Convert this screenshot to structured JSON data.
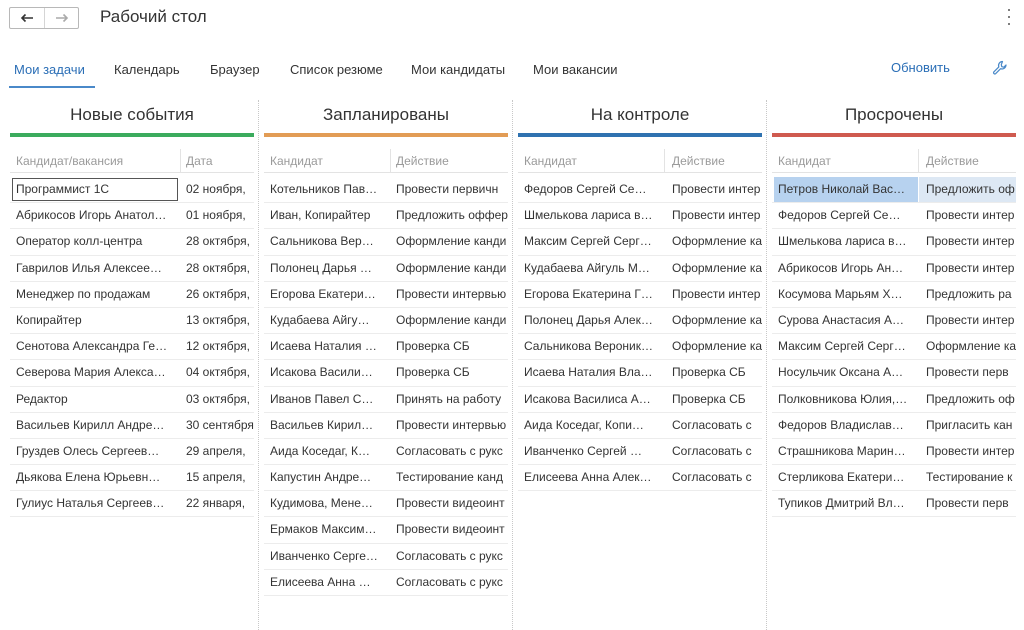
{
  "window": {
    "title": "Рабочий стол"
  },
  "icons": {
    "back": "arrow-left-icon",
    "forward": "arrow-right-icon",
    "menu": "kebab-menu-icon",
    "settings": "wrench-icon"
  },
  "tabs": [
    "Мои задачи",
    "Календарь",
    "Браузер",
    "Список резюме",
    "Мои кандидаты",
    "Мои вакансии"
  ],
  "actions": {
    "refresh": "Обновить"
  },
  "colors": {
    "accent": "#2a6eb6",
    "new": "#3bab5d",
    "planned": "#e29c55",
    "control": "#2f72b0",
    "overdue": "#cf5a4f",
    "selected": "#b7d2ef"
  },
  "columns": [
    {
      "title": "Новые события",
      "headers": [
        "Кандидат/вакансия",
        "Дата"
      ],
      "rows": [
        [
          "Программист 1С",
          "02 ноября,"
        ],
        [
          "Абрикосов Игорь Анатол…",
          "01 ноября,"
        ],
        [
          "Оператор колл-центра",
          "28 октября,"
        ],
        [
          "Гаврилов Илья Алексее…",
          "28 октября,"
        ],
        [
          "Менеджер по продажам",
          "26 октября,"
        ],
        [
          "Копирайтер",
          "13 октября,"
        ],
        [
          "Сенотова Александра Ге…",
          "12 октября,"
        ],
        [
          "Северова Мария Алекса…",
          "04 октября,"
        ],
        [
          "Редактор",
          "03 октября,"
        ],
        [
          "Васильев Кирилл Андре…",
          "30 сентября"
        ],
        [
          "Груздев Олесь Сергеев…",
          "29 апреля,"
        ],
        [
          "Дьякова Елена Юрьевн…",
          "15 апреля,"
        ],
        [
          "Гулиус Наталья Сергеев…",
          "22 января,"
        ]
      ]
    },
    {
      "title": "Запланированы",
      "headers": [
        "Кандидат",
        "Действие"
      ],
      "rows": [
        [
          "Котельников Пав…",
          "Провести первичн"
        ],
        [
          "Иван, Копирайтер",
          "Предложить оффер"
        ],
        [
          "Сальникова Вер…",
          "Оформление канди"
        ],
        [
          "Полонец Дарья …",
          "Оформление канди"
        ],
        [
          "Егорова Екатери…",
          "Провести интервью"
        ],
        [
          "Кудабаева Айгу…",
          "Оформление канди"
        ],
        [
          "Исаева Наталия …",
          "Проверка СБ"
        ],
        [
          "Исакова Васили…",
          "Проверка СБ"
        ],
        [
          "Иванов Павел С…",
          "Принять на работу"
        ],
        [
          "Васильев Кирил…",
          "Провести интервью"
        ],
        [
          "Аида Коседаг, К…",
          "Согласовать с рукс"
        ],
        [
          "Капустин Андре…",
          "Тестирование канд"
        ],
        [
          "Кудимова, Мене…",
          "Провести видеоинт"
        ],
        [
          "Ермаков Максим…",
          "Провести видеоинт"
        ],
        [
          "Иванченко Серге…",
          "Согласовать с рукс"
        ],
        [
          "Елисеева Анна …",
          "Согласовать с рукс"
        ]
      ]
    },
    {
      "title": "На контроле",
      "headers": [
        "Кандидат",
        "Действие"
      ],
      "rows": [
        [
          "Федоров Сергей Се…",
          "Провести интер"
        ],
        [
          "Шмелькова лариса в…",
          "Провести интер"
        ],
        [
          "Максим Сергей Серг…",
          "Оформление ка"
        ],
        [
          "Кудабаева Айгуль М…",
          "Оформление ка"
        ],
        [
          "Егорова Екатерина Г…",
          "Провести интер"
        ],
        [
          "Полонец Дарья Алек…",
          "Оформление ка"
        ],
        [
          "Сальникова Вероник…",
          "Оформление ка"
        ],
        [
          "Исаева Наталия Вла…",
          "Проверка СБ"
        ],
        [
          "Исакова Василиса А…",
          "Проверка СБ"
        ],
        [
          "Аида Коседаг, Копи…",
          "Согласовать с"
        ],
        [
          "Иванченко Сергей …",
          "Согласовать с"
        ],
        [
          "Елисеева Анна Алек…",
          "Согласовать с"
        ]
      ]
    },
    {
      "title": "Просрочены",
      "headers": [
        "Кандидат",
        "Действие"
      ],
      "rows": [
        [
          "Петров Николай Вас…",
          "Предложить оф"
        ],
        [
          "Федоров Сергей Се…",
          "Провести интер"
        ],
        [
          "Шмелькова лариса в…",
          "Провести интер"
        ],
        [
          "Абрикосов Игорь Ан…",
          "Провести интер"
        ],
        [
          "Косумова Марьям Х…",
          "Предложить ра"
        ],
        [
          "Сурова Анастасия А…",
          "Провести интер"
        ],
        [
          "Максим Сергей Серг…",
          "Оформление ка"
        ],
        [
          "Носульчик Оксана А…",
          "Провести перв"
        ],
        [
          "Полковникова Юлия,…",
          "Предложить оф"
        ],
        [
          "Федоров Владислав…",
          "Пригласить кан"
        ],
        [
          "Страшникова Марин…",
          "Провести интер"
        ],
        [
          "Стерликова Екатери…",
          "Тестирование к"
        ],
        [
          "Тупиков Дмитрий Вл…",
          "Провести перв"
        ]
      ]
    }
  ]
}
